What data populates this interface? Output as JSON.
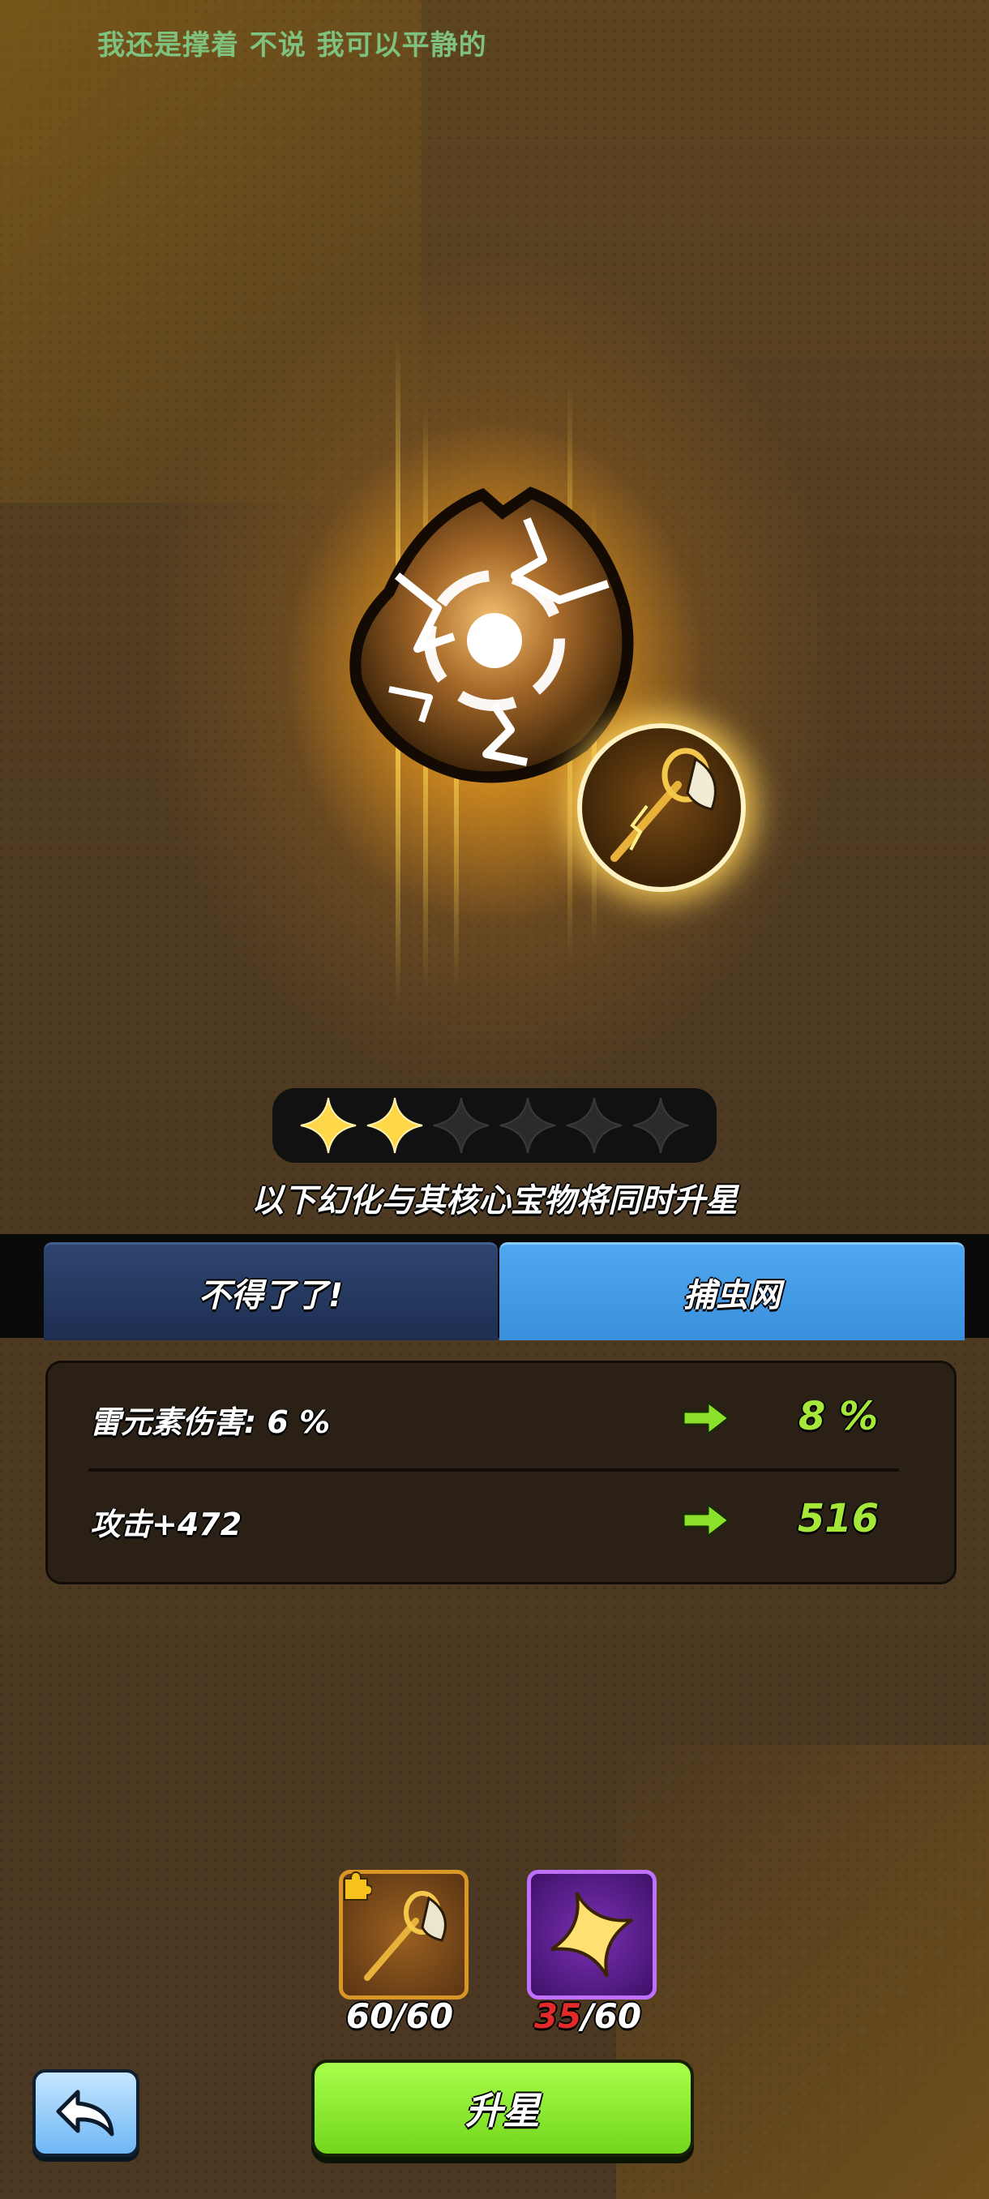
{
  "header": {
    "subtitle": "我还是撑着 不说 我可以平静的"
  },
  "star_rating": {
    "filled": 2,
    "total": 6
  },
  "info_text": "以下幻化与其核心宝物将同时升星",
  "tabs": [
    {
      "label": "不得了了!",
      "selected": false
    },
    {
      "label": "捕虫网",
      "selected": true
    }
  ],
  "stats": [
    {
      "label": "雷元素伤害: 6 %",
      "next": "8 %"
    },
    {
      "label": "攻击+472",
      "next": "516"
    }
  ],
  "materials": [
    {
      "icon": "bug-net-icon",
      "current": "60",
      "required": "/60",
      "count": "60/60"
    },
    {
      "icon": "star-shard-icon",
      "current": "35",
      "required": "/60"
    }
  ],
  "buttons": {
    "back_icon": "back-arrow-icon",
    "upgrade_label": "升星"
  },
  "colors": {
    "tab_selected": "#3a8fdc",
    "tab_unselected": "#1d2e51",
    "stat_value": "#a6e83a",
    "upgrade_button": "#73d61d",
    "shortage": "#e22a2a"
  }
}
